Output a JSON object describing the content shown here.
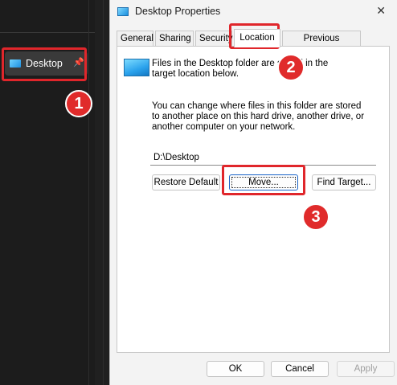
{
  "explorer": {
    "desktop_label": "Desktop"
  },
  "dialog": {
    "title": "Desktop Properties",
    "tabs": [
      {
        "label": "General"
      },
      {
        "label": "Sharing"
      },
      {
        "label": "Security"
      },
      {
        "label": "Location"
      },
      {
        "label": "Previous Versions"
      }
    ],
    "active_tab": "Location",
    "info_line1": "Files in the Desktop folder are stored in the target location below.",
    "info_line2": "You can change where files in this folder are stored to another place on this hard drive, another drive, or another computer on your network.",
    "path_value": "D:\\Desktop",
    "restore_label": "Restore Default",
    "move_label": "Move...",
    "find_label": "Find Target...",
    "ok_label": "OK",
    "cancel_label": "Cancel",
    "apply_label": "Apply"
  },
  "annotations": {
    "step1": "1",
    "step2": "2",
    "step3": "3",
    "highlight_color": "#e0262b",
    "badge_color": "#e02b2b"
  }
}
